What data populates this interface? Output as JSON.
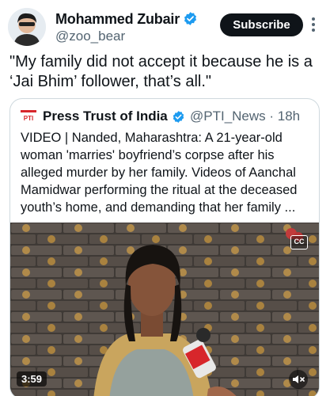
{
  "author": {
    "name": "Mohammed Zubair",
    "handle": "@zoo_bear",
    "avatar_icon": "avatar",
    "verified_icon": "verified-badge-icon",
    "verified_color": "#1d9bf0"
  },
  "actions": {
    "subscribe_label": "Subscribe",
    "more_icon": "more-vertical-icon"
  },
  "tweet": {
    "text": "\"My family did not accept it because he is a ‘Jai Bhim’ follower, that’s all.\""
  },
  "quote": {
    "logo_text": "PTI",
    "name": "Press Trust of India",
    "handle_time": "@PTI_News · 18h",
    "text": "VIDEO | Nanded, Maharashtra: A 21-year-old woman 'marries' boyfriend’s corpse after his alleged murder by her family. Videos of Aanchal Mamidwar performing the ritual at the deceased youth’s home, and demanding that her family ..."
  },
  "video": {
    "cc_label": "CC",
    "duration": "3:59",
    "mute_icon": "speaker-muted-icon"
  },
  "colors": {
    "text": "#0f1419",
    "secondary": "#536471",
    "border": "#cfd9de",
    "accent": "#1d9bf0"
  }
}
